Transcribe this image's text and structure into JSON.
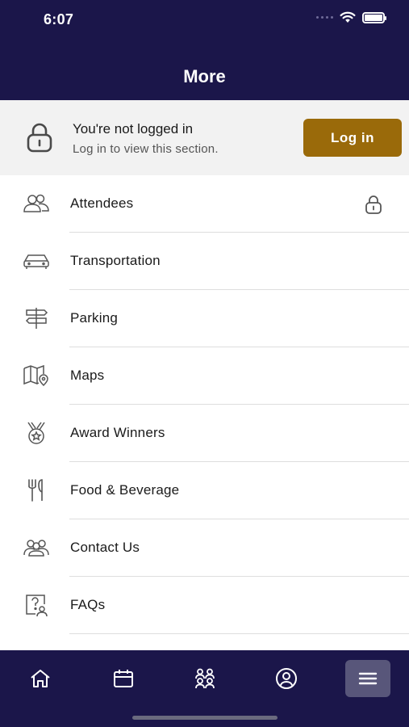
{
  "status_bar": {
    "time": "6:07"
  },
  "header": {
    "title": "More"
  },
  "login": {
    "title": "You're not logged in",
    "subtitle": "Log in to view this section.",
    "button_label": "Log in"
  },
  "menu": [
    {
      "label": "Attendees",
      "icon": "attendees-icon",
      "locked": true
    },
    {
      "label": "Transportation",
      "icon": "car-icon",
      "locked": false
    },
    {
      "label": "Parking",
      "icon": "signpost-icon",
      "locked": false
    },
    {
      "label": "Maps",
      "icon": "map-icon",
      "locked": false
    },
    {
      "label": "Award Winners",
      "icon": "medal-icon",
      "locked": false
    },
    {
      "label": "Food & Beverage",
      "icon": "fork-knife-icon",
      "locked": false
    },
    {
      "label": "Contact Us",
      "icon": "contact-people-icon",
      "locked": false
    },
    {
      "label": "FAQs",
      "icon": "faq-icon",
      "locked": false
    }
  ],
  "tabbar": [
    {
      "icon": "home-icon",
      "active": false
    },
    {
      "icon": "calendar-icon",
      "active": false
    },
    {
      "icon": "people-icon",
      "active": false
    },
    {
      "icon": "profile-icon",
      "active": false
    },
    {
      "icon": "menu-icon",
      "active": true
    }
  ],
  "colors": {
    "header_bg": "#1b164a",
    "accent": "#9a6a0a",
    "banner_bg": "#f2f2f2",
    "active_tab": "#58567a"
  }
}
